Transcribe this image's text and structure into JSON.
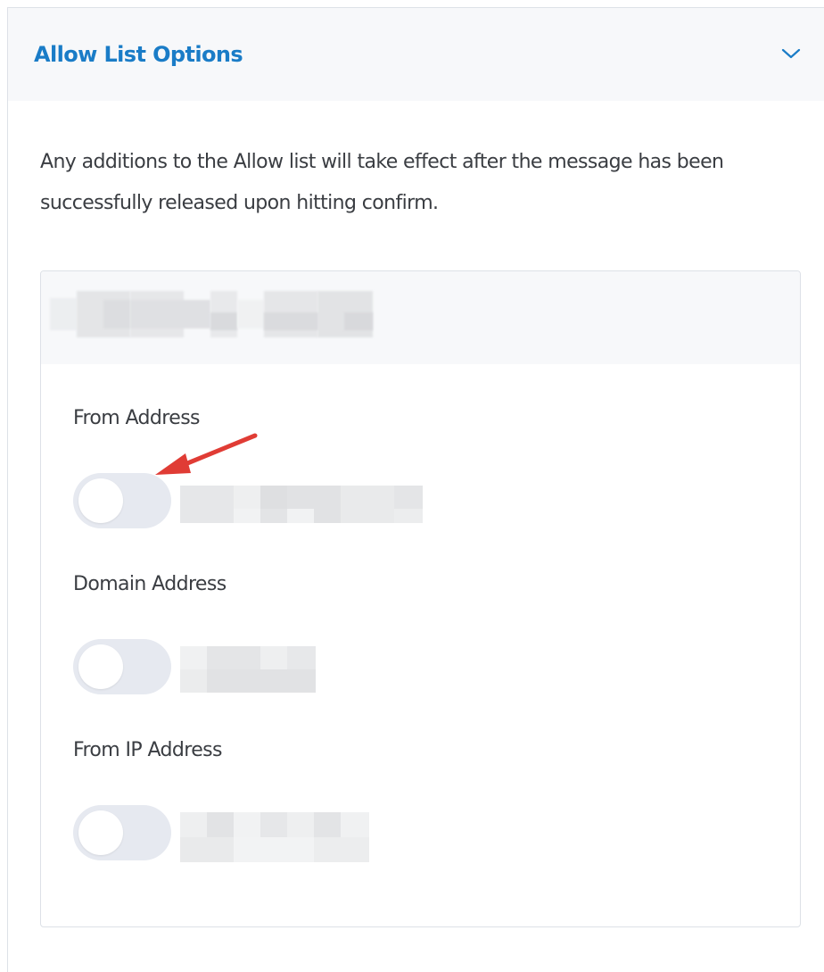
{
  "section": {
    "title": "Allow List Options",
    "expanded": true
  },
  "description": "Any additions to the Allow list will take effect after the message has been successfully released upon hitting confirm.",
  "card": {
    "header_redacted": true,
    "fields": [
      {
        "label": "From Address",
        "toggle_on": false,
        "value_redacted": true
      },
      {
        "label": "Domain Address",
        "toggle_on": false,
        "value_redacted": true
      },
      {
        "label": "From IP Address",
        "toggle_on": false,
        "value_redacted": true
      }
    ]
  },
  "colors": {
    "accent": "#1a7cc7",
    "text": "#3a3d42",
    "toggle_track": "#e6e9f0",
    "annotation_arrow": "#e03c35",
    "border": "#dde1e7"
  },
  "icons": {
    "expand": "chevron-down-icon",
    "annotation": "red-arrow-annotation"
  }
}
